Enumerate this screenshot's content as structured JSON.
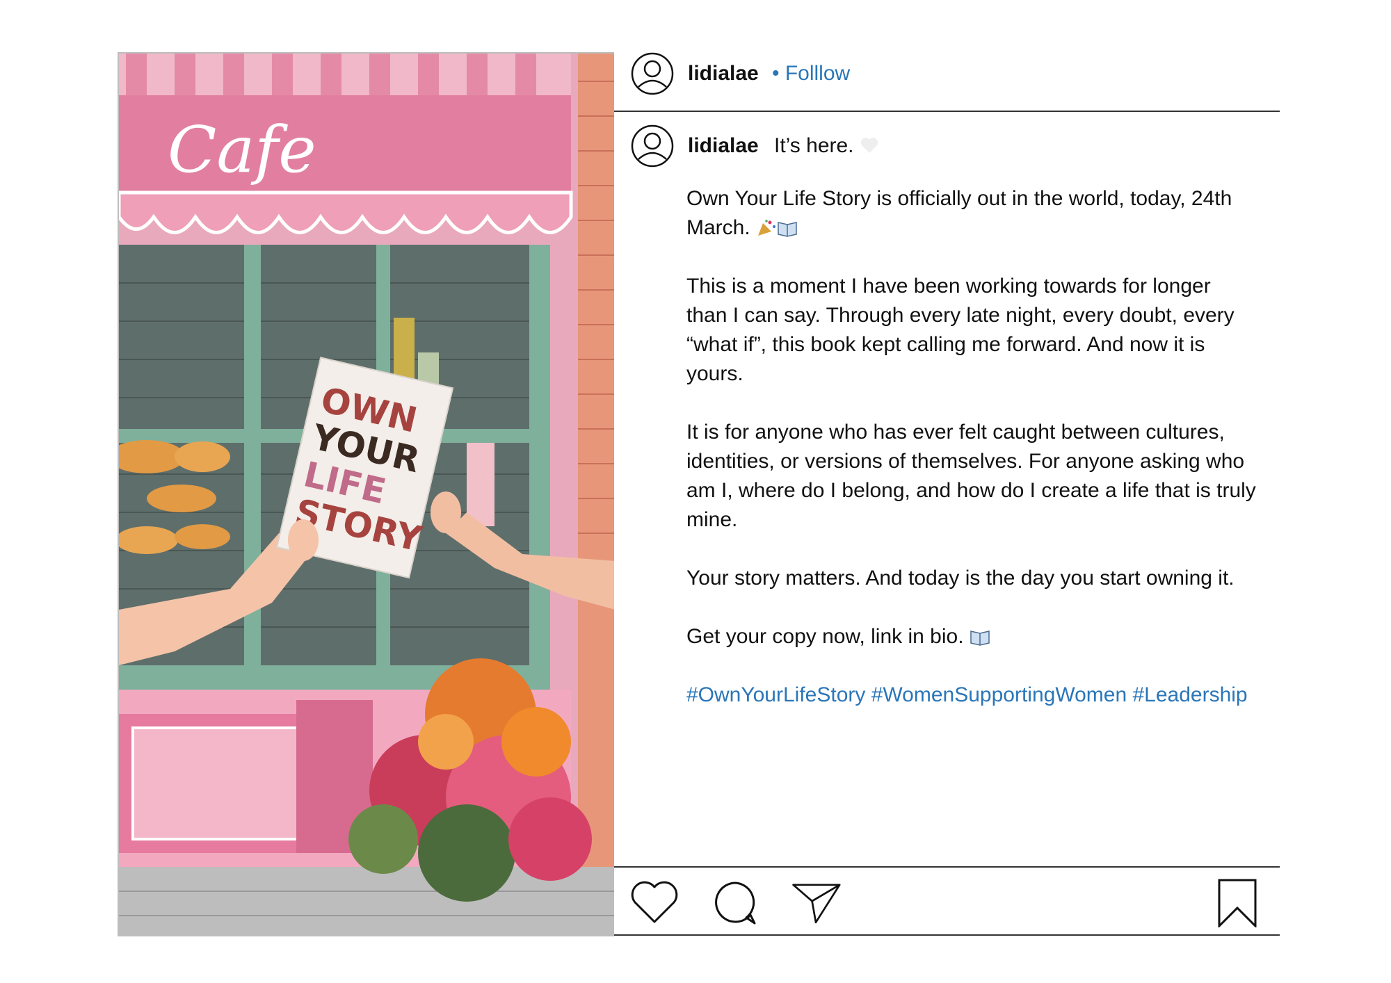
{
  "post": {
    "header": {
      "username": "lidialae",
      "follow_label": "• Folllow"
    },
    "caption": {
      "username": "lidialae",
      "first_line": "It’s here.",
      "paragraphs": [
        "Own Your Life Story is officially out in the world, today, 24th March.",
        "This is a moment I have been working towards for longer than I can say. Through every late night, every doubt, every “what if”, this book kept calling me forward. And now it is yours.",
        "It is for anyone who has ever felt caught between cultures, identities, or versions of themselves. For anyone asking who am I, where do I belong, and how do I create a life that is truly mine.",
        "Your story matters. And today is the day you start owning it.",
        "Get your copy now, link in bio."
      ],
      "hashtags": "#OwnYourLifeStory #WomenSupportingWomen #Leadership"
    },
    "image": {
      "sign_text": "Cafe",
      "book_title": [
        "OWN",
        "YOUR",
        "LIFE",
        "STORY"
      ]
    },
    "actions": [
      "heart-icon",
      "comment-icon",
      "share-icon",
      "bookmark-icon"
    ],
    "colors": {
      "link": "#2a76b8",
      "divider": "#333333"
    }
  }
}
